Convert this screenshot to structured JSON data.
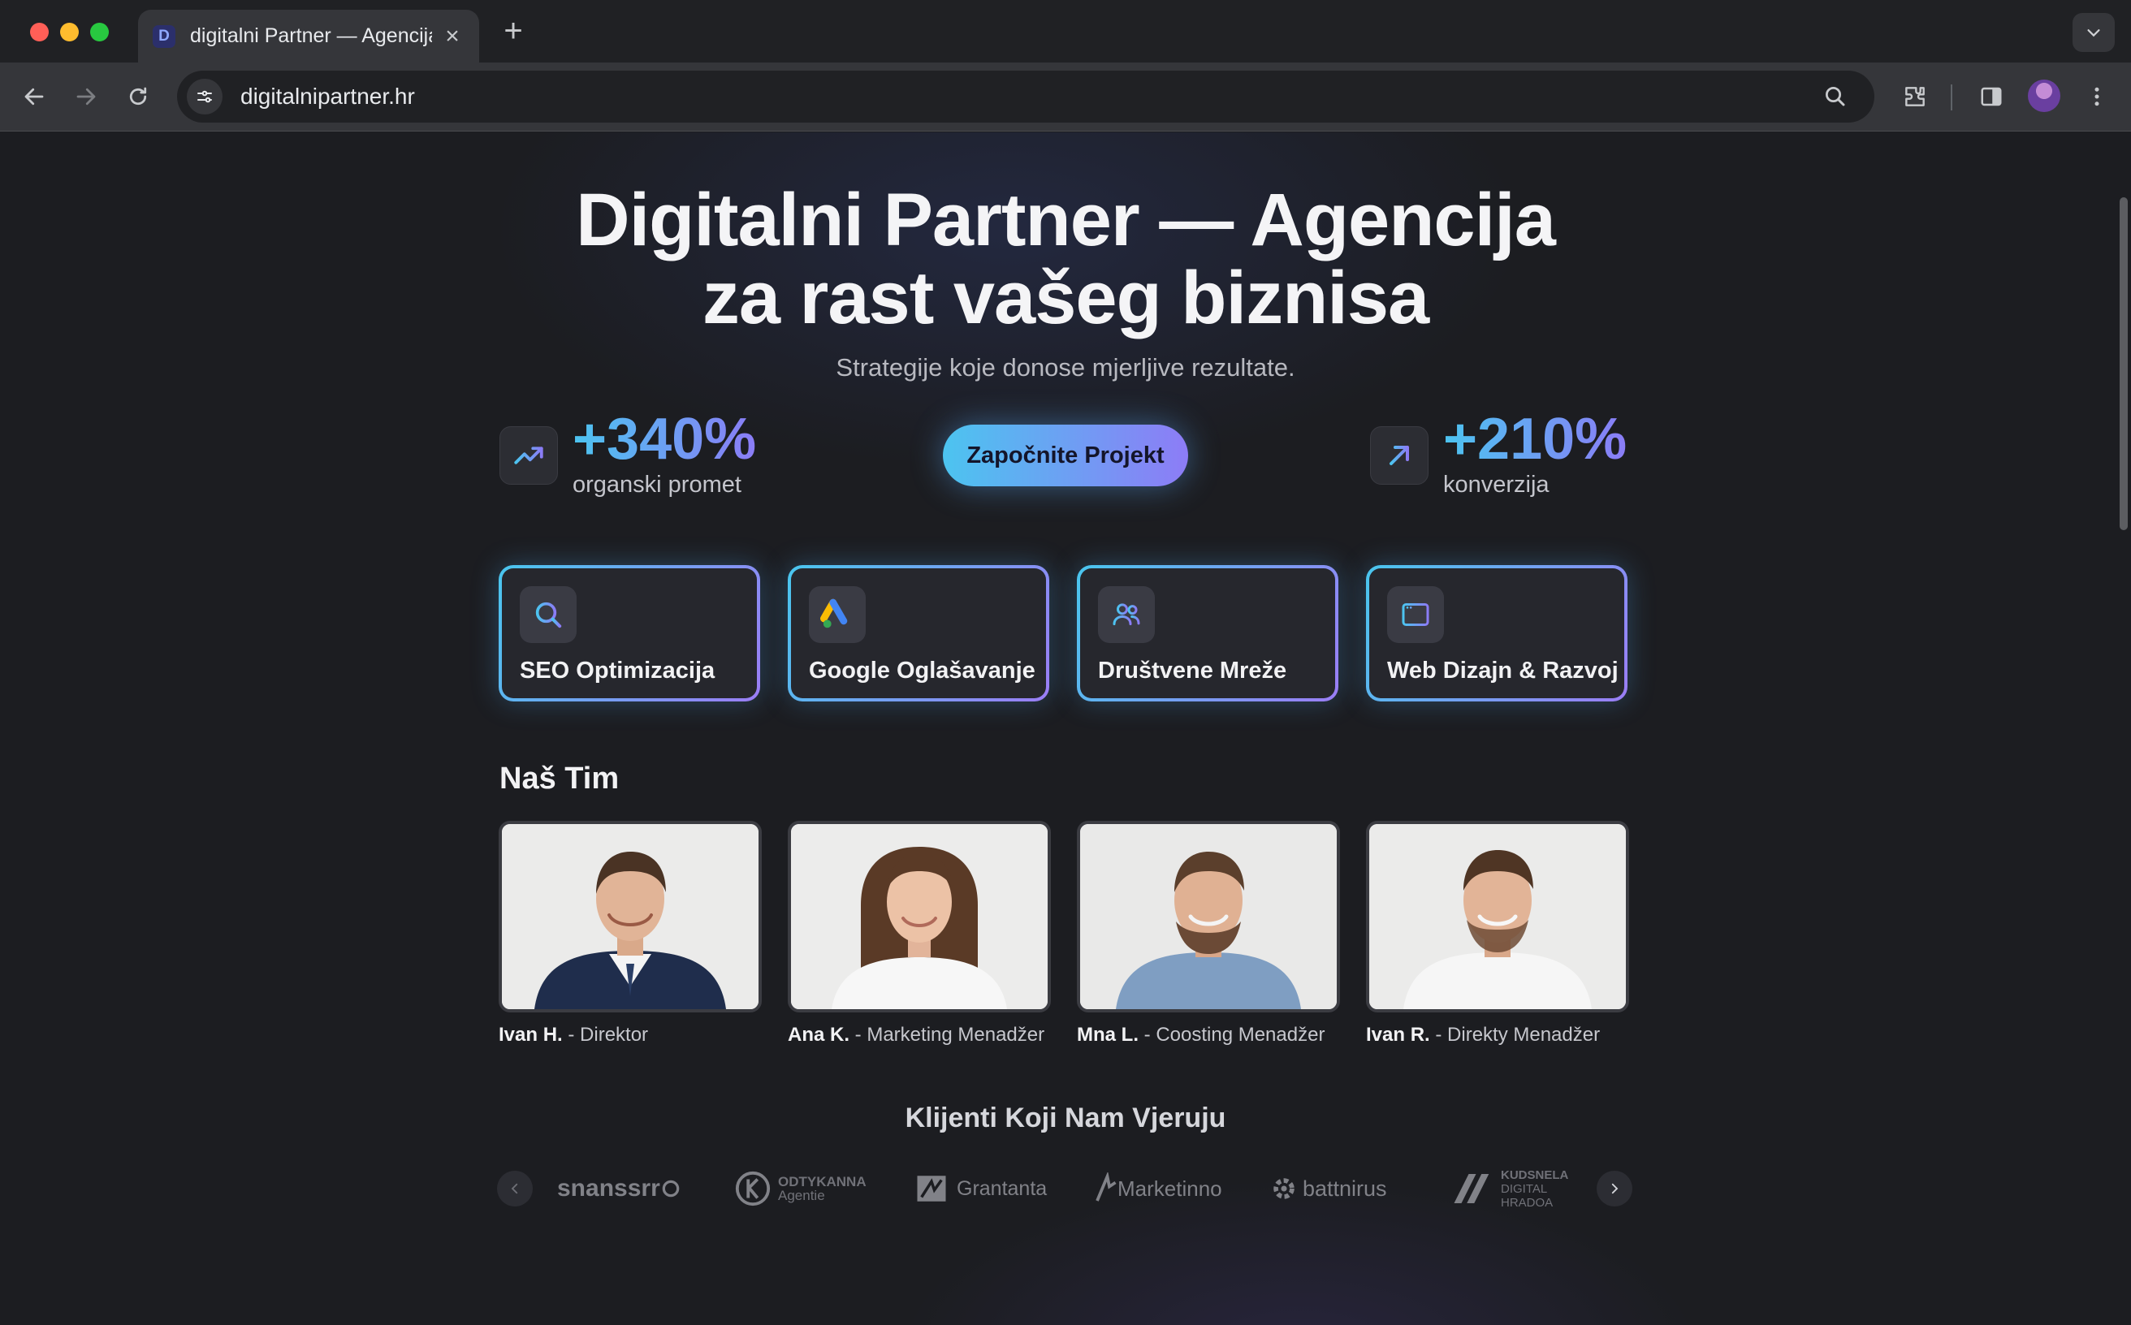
{
  "browser": {
    "tab_title": "digitalni Partner — Agencija",
    "favicon_letter": "D",
    "url": "digitalnipartner.hr"
  },
  "hero": {
    "title_line1": "Digitalni Partner — Agencija",
    "title_line2": "za rast vašeg biznisa",
    "subtitle": "Strategije koje donose mjerljive rezultate.",
    "cta_label": "Započnite Projekt"
  },
  "stats": [
    {
      "value": "+340%",
      "label": "organski promet",
      "icon": "trending-up-icon"
    },
    {
      "value": "+210%",
      "label": "konverzija",
      "icon": "arrow-up-right-icon"
    }
  ],
  "services": [
    {
      "label": "SEO Optimizacija",
      "icon": "search-icon"
    },
    {
      "label": "Google Oglašavanje",
      "icon": "google-ads-icon"
    },
    {
      "label": "Društvene Mreže",
      "icon": "users-icon"
    },
    {
      "label": "Web Dizajn & Razvoj",
      "icon": "browser-window-icon"
    }
  ],
  "team": {
    "heading": "Naš Tim",
    "members": [
      {
        "name": "Ivan H.",
        "role": " - Direktor"
      },
      {
        "name": "Ana K.",
        "role": " - Marketing Menadžer"
      },
      {
        "name": "Mna L.",
        "role": " - Coosting Menadžer"
      },
      {
        "name": "Ivan R.",
        "role": " - Direkty Menadžer"
      }
    ]
  },
  "clients": {
    "heading": "Klijenti Koji Nam Vjeruju",
    "logos": [
      {
        "name": "snanssrr",
        "sub": ""
      },
      {
        "name": "ODTYKANNA",
        "sub": "Agentie"
      },
      {
        "name": "Grantanta",
        "sub": ""
      },
      {
        "name": "Marketinno",
        "sub": ""
      },
      {
        "name": "battnirus",
        "sub": ""
      },
      {
        "name": "KUDSNELA",
        "sub": "DIGITAL HRADOA"
      }
    ]
  },
  "colors": {
    "accent_cyan": "#4cc4f0",
    "accent_violet": "#8b7cf6",
    "page_bg": "#1c1d21"
  }
}
